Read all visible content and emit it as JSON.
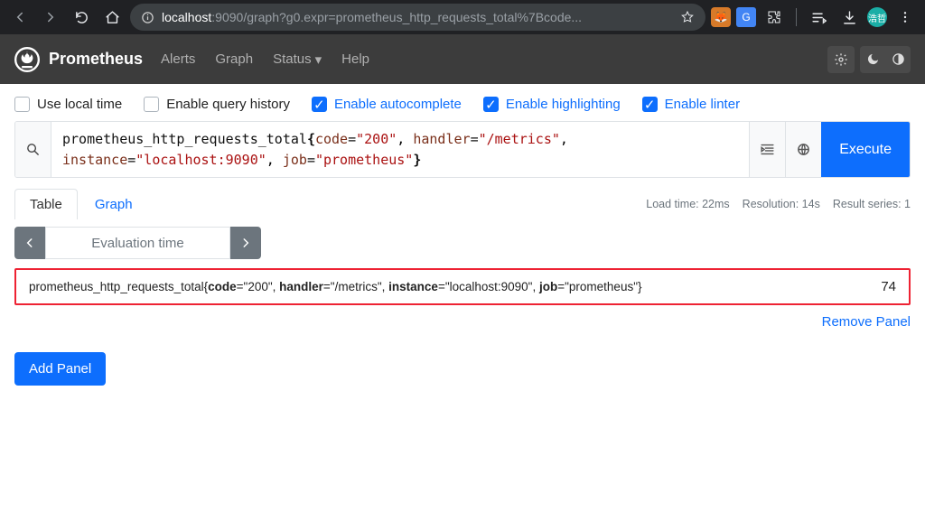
{
  "browser": {
    "url_host": "localhost",
    "url_port": ":9090",
    "url_path": "/graph?g0.expr=prometheus_http_requests_total%7Bcode...",
    "avatar_text": "浩哲"
  },
  "header": {
    "title": "Prometheus",
    "nav": {
      "alerts": "Alerts",
      "graph": "Graph",
      "status": "Status",
      "help": "Help"
    }
  },
  "toggles": {
    "local_time": "Use local time",
    "history": "Enable query history",
    "autocomplete": "Enable autocomplete",
    "highlight": "Enable highlighting",
    "linter": "Enable linter"
  },
  "query": {
    "metric": "prometheus_http_requests_total",
    "labels": [
      {
        "k": "code",
        "v": "\"200\""
      },
      {
        "k": "handler",
        "v": "\"/metrics\""
      },
      {
        "k": "instance",
        "v": "\"localhost:9090\""
      },
      {
        "k": "job",
        "v": "\"prometheus\""
      }
    ],
    "execute_label": "Execute"
  },
  "tabs": {
    "table": "Table",
    "graph": "Graph"
  },
  "meta": {
    "load_time": "Load time: 22ms",
    "resolution": "Resolution: 14s",
    "series": "Result series: 1"
  },
  "eval": {
    "label": "Evaluation time"
  },
  "result": {
    "metric": "prometheus_http_requests_total",
    "labels": [
      {
        "k": "code",
        "v": "\"200\""
      },
      {
        "k": "handler",
        "v": "\"/metrics\""
      },
      {
        "k": "instance",
        "v": "\"localhost:9090\""
      },
      {
        "k": "job",
        "v": "\"prometheus\""
      }
    ],
    "value": "74"
  },
  "links": {
    "remove_panel": "Remove Panel",
    "add_panel": "Add Panel"
  }
}
